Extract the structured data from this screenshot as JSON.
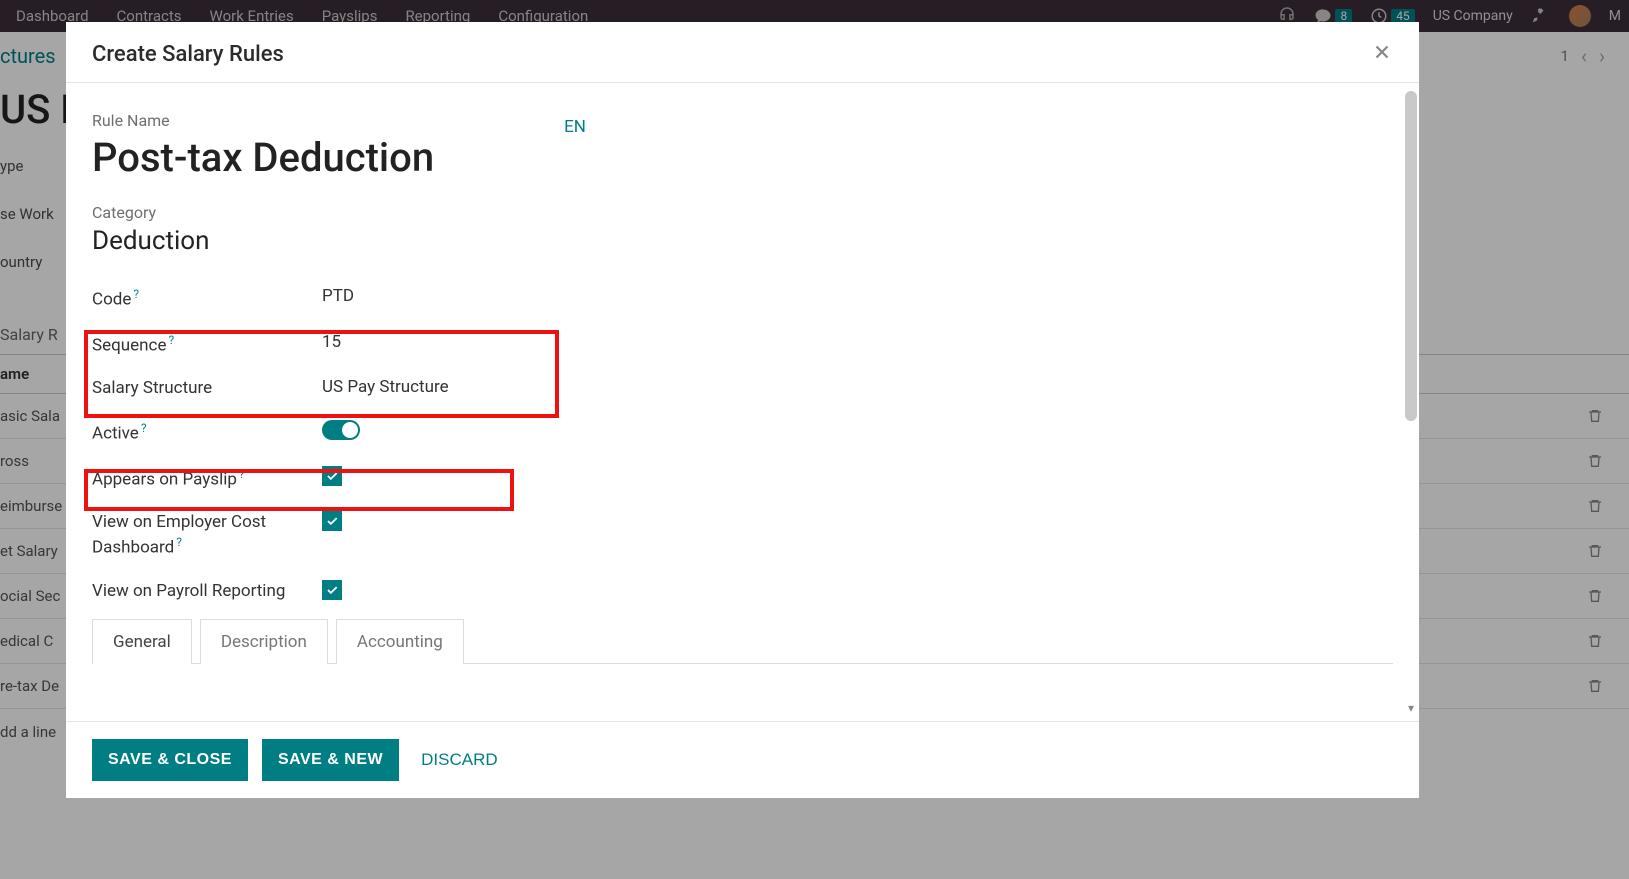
{
  "topbar": {
    "menu": [
      "Dashboard",
      "Contracts",
      "Work Entries",
      "Payslips",
      "Reporting",
      "Configuration"
    ],
    "chat_badge": "8",
    "clock_badge": "45",
    "company": "US Company",
    "user_initial": "M"
  },
  "bg": {
    "breadcrumb_tail": "ctures",
    "title_prefix": "US P",
    "labels": [
      "ype",
      "se Work",
      "ountry"
    ],
    "salary_rule_header": "Salary R",
    "rulename_header": "ame",
    "rules": [
      "asic Sala",
      "ross",
      "eimburse",
      "et Salary",
      "ocial Sec",
      "edical C",
      "re-tax De",
      "dd a line"
    ],
    "pager_text": "1"
  },
  "modal": {
    "title": "Create Salary Rules",
    "rule_name_label": "Rule Name",
    "rule_name_value": "Post-tax Deduction",
    "lang_button": "EN",
    "category_label": "Category",
    "category_value": "Deduction",
    "fields": {
      "code": {
        "label": "Code",
        "value": "PTD",
        "help": true
      },
      "sequence": {
        "label": "Sequence",
        "value": "15",
        "help": true
      },
      "structure": {
        "label": "Salary Structure",
        "value": "US Pay Structure",
        "help": false
      },
      "active": {
        "label": "Active",
        "help": true
      },
      "appears": {
        "label": "Appears on Payslip",
        "help": true
      },
      "employer": {
        "label": "View on Employer Cost Dashboard",
        "help": true
      },
      "reporting": {
        "label": "View on Payroll Reporting",
        "help": false
      }
    },
    "tabs": [
      "General",
      "Description",
      "Accounting"
    ],
    "buttons": {
      "save_close": "SAVE & CLOSE",
      "save_new": "SAVE & NEW",
      "discard": "DISCARD"
    }
  }
}
